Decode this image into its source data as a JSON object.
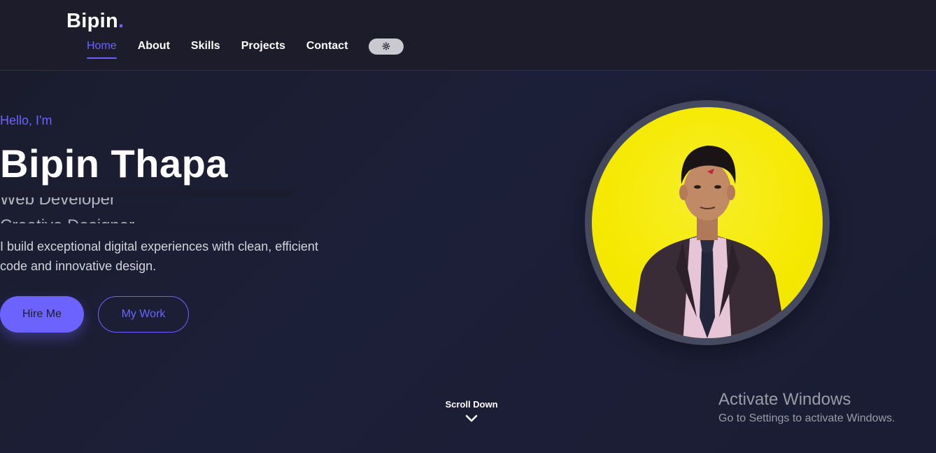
{
  "header": {
    "logo_text": "Bipin",
    "logo_dot": ".",
    "nav": [
      {
        "label": "Home",
        "active": true
      },
      {
        "label": "About",
        "active": false
      },
      {
        "label": "Skills",
        "active": false
      },
      {
        "label": "Projects",
        "active": false
      },
      {
        "label": "Contact",
        "active": false
      }
    ],
    "theme_toggle_icon": "gear-icon"
  },
  "hero": {
    "greeting": "Hello, I'm",
    "name": "Bipin Thapa",
    "roles": [
      "Web Developer",
      "Creative Designer"
    ],
    "tagline": "I build exceptional digital experiences with clean, efficient code and innovative design.",
    "primary_button": "Hire Me",
    "secondary_button": "My Work",
    "avatar_alt": "profile-photo"
  },
  "scroll": {
    "label": "Scroll Down",
    "icon": "chevron-down-icon"
  },
  "watermark": {
    "title": "Activate Windows",
    "subtitle": "Go to Settings to activate Windows."
  },
  "colors": {
    "accent": "#6c63ff",
    "header_bg": "#1c1c2a",
    "page_bg": "#1a1d30",
    "avatar_bg": "#f5e900"
  }
}
